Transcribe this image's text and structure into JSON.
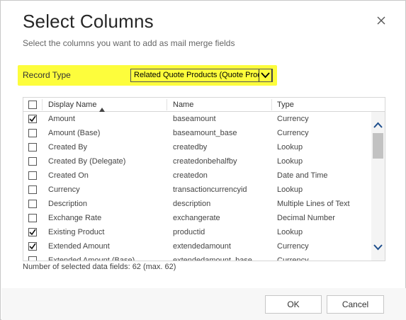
{
  "dialog": {
    "title": "Select Columns",
    "subtitle": "Select the columns you want to add as mail merge fields"
  },
  "record_type": {
    "label": "Record Type",
    "value": "Related Quote Products (Quote Product)",
    "highlight_color": "#fdfd3c"
  },
  "grid": {
    "columns": [
      "Display Name",
      "Name",
      "Type"
    ],
    "sort_indicator": "up-triangle-icon",
    "rows": [
      {
        "checked": true,
        "display": "Amount",
        "name": "baseamount",
        "type": "Currency"
      },
      {
        "checked": false,
        "display": "Amount (Base)",
        "name": "baseamount_base",
        "type": "Currency"
      },
      {
        "checked": false,
        "display": "Created By",
        "name": "createdby",
        "type": "Lookup"
      },
      {
        "checked": false,
        "display": "Created By (Delegate)",
        "name": "createdonbehalfby",
        "type": "Lookup"
      },
      {
        "checked": false,
        "display": "Created On",
        "name": "createdon",
        "type": "Date and Time"
      },
      {
        "checked": false,
        "display": "Currency",
        "name": "transactioncurrencyid",
        "type": "Lookup"
      },
      {
        "checked": false,
        "display": "Description",
        "name": "description",
        "type": "Multiple Lines of Text"
      },
      {
        "checked": false,
        "display": "Exchange Rate",
        "name": "exchangerate",
        "type": "Decimal Number"
      },
      {
        "checked": true,
        "display": "Existing Product",
        "name": "productid",
        "type": "Lookup"
      },
      {
        "checked": true,
        "display": "Extended Amount",
        "name": "extendedamount",
        "type": "Currency"
      },
      {
        "checked": false,
        "display": "Extended Amount (Base)",
        "name": "extendedamount_base",
        "type": "Currency"
      }
    ]
  },
  "status": {
    "count_text": "Number of selected data fields: 62 (max. 62)"
  },
  "buttons": {
    "ok": "OK",
    "cancel": "Cancel"
  }
}
